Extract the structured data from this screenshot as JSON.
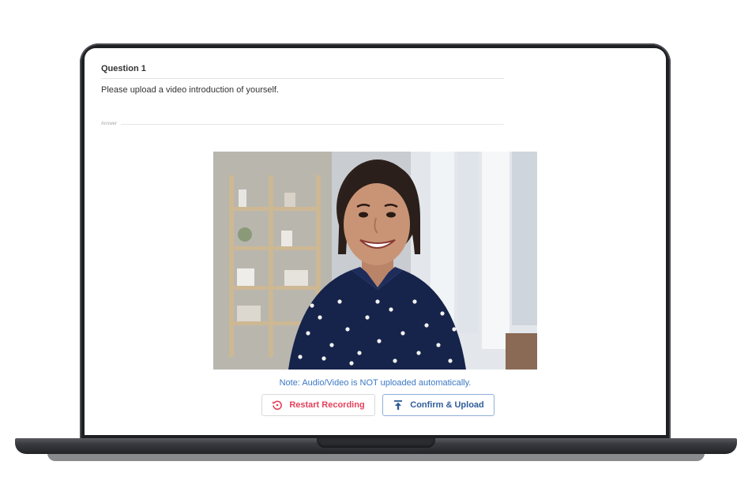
{
  "question": {
    "title": "Question 1",
    "prompt": "Please upload a video introduction of yourself."
  },
  "answer": {
    "label": "Answer"
  },
  "video": {
    "description_icon": "video-preview"
  },
  "note": "Note: Audio/Video is NOT uploaded automatically.",
  "actions": {
    "restart_label": "Restart Recording",
    "restart_icon": "restart-icon",
    "confirm_label": "Confirm & Upload",
    "confirm_icon": "upload-icon"
  },
  "colors": {
    "restart": "#e5405a",
    "confirm": "#2f5d99",
    "note": "#3b78c4"
  }
}
